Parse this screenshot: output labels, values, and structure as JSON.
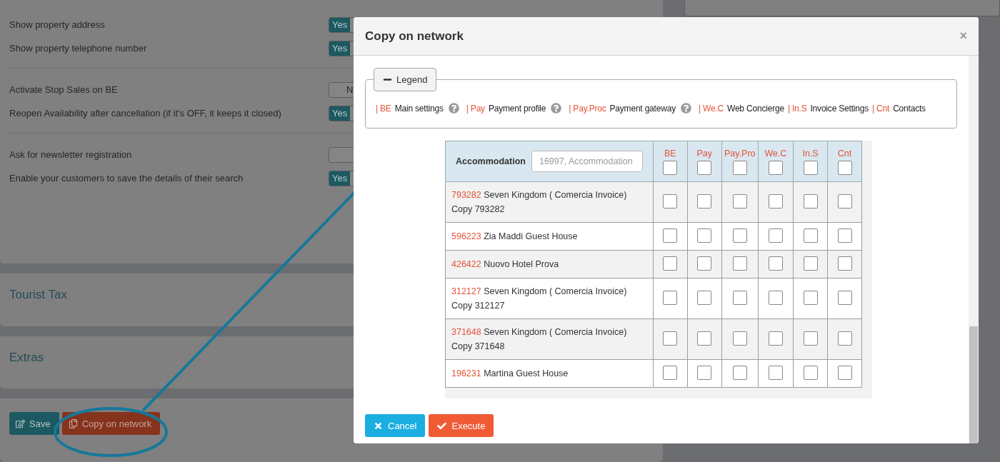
{
  "settings_groups": [
    [
      {
        "label": "Show property address",
        "toggle": {
          "on": true,
          "text": "Yes"
        }
      },
      {
        "label": "Show property telephone number",
        "toggle": {
          "on": true,
          "text": "Yes"
        }
      }
    ],
    [
      {
        "label": "Activate Stop Sales on BE",
        "toggle": {
          "on": false,
          "text": "N"
        }
      },
      {
        "label": "Reopen Availability after cancellation (if it's OFF, it keeps it closed)",
        "toggle": {
          "on": true,
          "text": "Yes"
        }
      }
    ],
    [
      {
        "label": "Ask for newsletter registration",
        "toggle": {
          "on": false
        }
      },
      {
        "label": "Enable your customers to save the details of their search",
        "toggle": {
          "on": true,
          "text": "Yes"
        }
      }
    ]
  ],
  "panels": [
    "Tourist Tax",
    "Extras"
  ],
  "actions": [
    {
      "label": "Save",
      "kind": "save",
      "highlighted": false
    },
    {
      "label": "Copy on network",
      "kind": "copy",
      "highlighted": true
    }
  ],
  "modal": {
    "title": "Copy on network",
    "close": "×",
    "legend": {
      "title": "Legend",
      "expanded": true,
      "items": [
        {
          "code": "| BE",
          "label": "Main settings",
          "help": true
        },
        {
          "code": "| Pay",
          "label": "Payment profile",
          "help": true
        },
        {
          "code": "| Pay.Proc",
          "label": "Payment gateway",
          "help": true
        },
        {
          "code": "| We.C",
          "label": "Web Concierge",
          "help": false
        },
        {
          "code": "| In.S",
          "label": "Invoice Settings",
          "help": false
        },
        {
          "code": "| Cnt",
          "label": "Contacts",
          "help": false
        }
      ]
    },
    "table": {
      "search_label": "Accommodation",
      "search_placeholder": "16997, Accommodation",
      "columns": [
        {
          "label": "BE",
          "checked": false
        },
        {
          "label": "Pay",
          "checked": false
        },
        {
          "label": "Pay.Pro",
          "checked": false
        },
        {
          "label": "We.C",
          "checked": false
        },
        {
          "label": "In.S",
          "checked": false
        },
        {
          "label": "Cnt",
          "checked": false
        }
      ],
      "rows": [
        {
          "id": "793282",
          "name": "Seven Kingdom ( Comercia Invoice) Copy 793282",
          "checks": [
            false,
            false,
            false,
            false,
            false,
            false
          ]
        },
        {
          "id": "596223",
          "name": "Zia Maddi Guest House",
          "checks": [
            false,
            false,
            false,
            false,
            false,
            false
          ]
        },
        {
          "id": "426422",
          "name": "Nuovo Hotel Prova",
          "checks": [
            false,
            false,
            false,
            false,
            false,
            false
          ]
        },
        {
          "id": "312127",
          "name": "Seven Kingdom ( Comercia Invoice) Copy 312127",
          "checks": [
            false,
            false,
            false,
            false,
            false,
            false
          ]
        },
        {
          "id": "371648",
          "name": "Seven Kingdom ( Comercia Invoice) Copy 371648",
          "checks": [
            false,
            false,
            false,
            false,
            false,
            false
          ]
        },
        {
          "id": "196231",
          "name": "Martina Guest House",
          "checks": [
            false,
            false,
            false,
            false,
            false,
            false
          ]
        }
      ]
    },
    "buttons": [
      {
        "label": "Cancel",
        "kind": "cancel"
      },
      {
        "label": "Execute",
        "kind": "execute"
      }
    ]
  }
}
